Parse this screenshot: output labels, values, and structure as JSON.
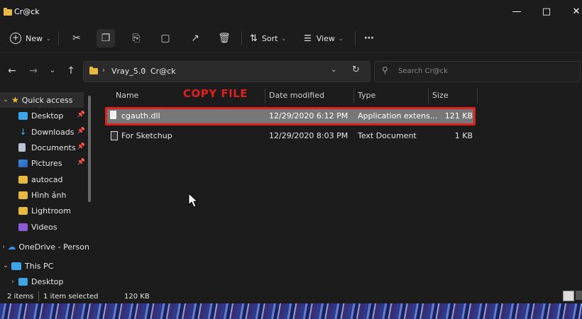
{
  "window": {
    "title": "Cr@ck"
  },
  "toolbar": {
    "new_label": "New",
    "sort_label": "Sort",
    "view_label": "View"
  },
  "address": {
    "crumbs": [
      "Vray_5.0",
      "Cr@ck"
    ],
    "search_placeholder": "Search Cr@ck"
  },
  "sidebar": {
    "quick_access": "Quick access",
    "items": [
      "Desktop",
      "Downloads",
      "Documents",
      "Pictures",
      "autocad",
      "Hình ảnh",
      "Lightroom",
      "Videos"
    ],
    "onedrive": "OneDrive - Person",
    "this_pc": "This PC",
    "pc_desktop": "Desktop"
  },
  "columns": {
    "name": "Name",
    "date": "Date modified",
    "type": "Type",
    "size": "Size"
  },
  "annotation": {
    "label": "COPY FILE",
    "color": "#e0201c"
  },
  "files": [
    {
      "name": "cgauth.dll",
      "date": "12/29/2020 6:12 PM",
      "type": "Application extens...",
      "size": "121 KB"
    },
    {
      "name": "For Sketchup",
      "date": "12/29/2020 8:03 PM",
      "type": "Text Document",
      "size": "1 KB"
    }
  ],
  "status": {
    "items": "2 items",
    "selected": "1 item selected",
    "size": "120 KB"
  }
}
